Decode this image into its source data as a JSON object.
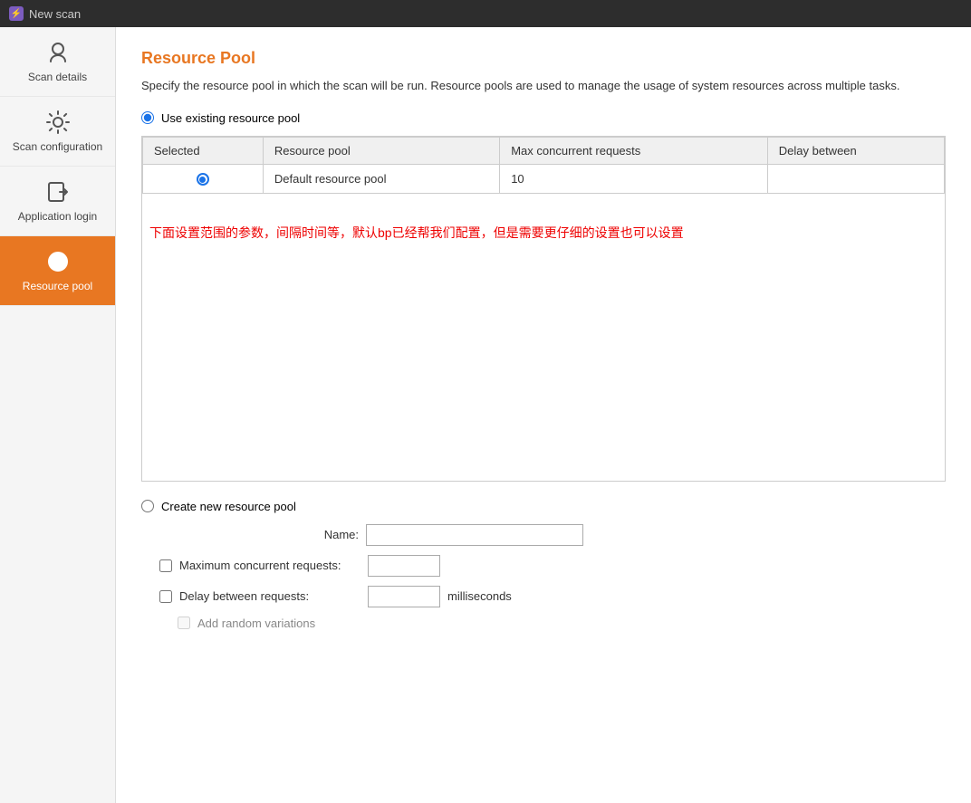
{
  "topbar": {
    "icon_label": "⚡",
    "title": "New scan"
  },
  "sidebar": {
    "items": [
      {
        "id": "scan-details",
        "label": "Scan details",
        "active": false
      },
      {
        "id": "scan-configuration",
        "label": "Scan configuration",
        "active": false
      },
      {
        "id": "application-login",
        "label": "Application login",
        "active": false
      },
      {
        "id": "resource-pool",
        "label": "Resource pool",
        "active": true
      }
    ]
  },
  "content": {
    "title": "Resource Pool",
    "description": "Specify the resource pool in which the scan will be run. Resource pools are used to manage the usage of system resources across multiple tasks.",
    "use_existing_label": "Use existing resource pool",
    "table": {
      "columns": [
        "Selected",
        "Resource pool",
        "Max concurrent requests",
        "Delay between"
      ],
      "rows": [
        {
          "selected": true,
          "resource_pool": "Default resource pool",
          "max_concurrent": "10",
          "delay": ""
        }
      ]
    },
    "chinese_note": "下面设置范围的参数，间隔时间等，默认bp已经帮我们配置，但是需要更仔细的设置也可以设置",
    "create_new_label": "Create new resource pool",
    "name_label": "Name:",
    "max_concurrent_label": "Maximum concurrent requests:",
    "delay_label": "Delay between requests:",
    "milliseconds_label": "milliseconds",
    "add_random_label": "Add random variations"
  }
}
